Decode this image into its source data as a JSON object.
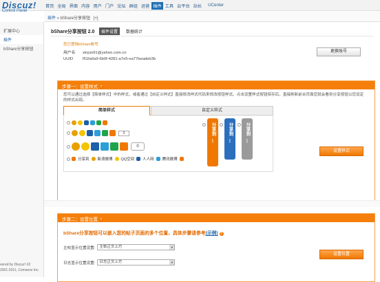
{
  "app": {
    "logo_name": "Discuz!",
    "logo_sub": "Control Panel"
  },
  "nav": {
    "items": [
      "首页",
      "全局",
      "界面",
      "内容",
      "用户",
      "门户",
      "论坛",
      "群组",
      "运营",
      "插件",
      "工具",
      "云平台",
      "站长",
      "UCenter"
    ],
    "active_index": 9
  },
  "breadcrumb": {
    "a": "插件",
    "b": "bShare分享按钮",
    "c": "[+]"
  },
  "sidebar": {
    "items": [
      "扩展中心",
      "插件",
      "bShare分享按钮"
    ],
    "active_index": 1,
    "footer_line1": "vered by Discuz! X2",
    "footer_line2": "2001-2011, Comsenz Inc."
  },
  "plugin": {
    "title": "bShare分享按钮 2.0",
    "tabs": [
      "插件设置",
      "数据统计"
    ],
    "notice": "您已登陆bShare帐号",
    "account": [
      {
        "label": "用户名",
        "value": "xinjun91@yahoo.com.cn"
      },
      {
        "label": "UUID",
        "value": "f51fa0a9-6b0f-4281-a7e5-ea77beadeb3b"
      }
    ],
    "change_account_label": "更换账号"
  },
  "step1": {
    "title": "步骤一：设置样式",
    "desc": "您可以通过选择【简单样式】中的样式，或者通过【自定义样式】直接修改样式代码来修改按钮样式。点击设置样式按钮保存后，直接刷新前台页面您就会看到分享按钮以您设定的样式出现。",
    "tab_simple": "简单样式",
    "tab_custom": "自定义样式",
    "count_small": "0",
    "count_large": "0",
    "share_label": "分享到",
    "service_labels": [
      "新浪微博",
      "QQ空间",
      "人人网",
      "腾讯微博"
    ],
    "vbtn_text": "分享到",
    "vbtn_colors": [
      "#f07800",
      "#2c6fbd",
      "#9a9a9a"
    ],
    "save_label": "设置样式"
  },
  "step2": {
    "title": "步骤二：设置位置",
    "headline": "bShare分享按钮可以嵌入您的帖子页面的多个位置，具体步骤请参考",
    "example_link": "[示例]",
    "rows": [
      {
        "label": "主帖显示位置设置:",
        "value": "主帖正文上方"
      },
      {
        "label": "日志显示位置设置:",
        "value": "日志正文上方"
      }
    ],
    "save_label": "设置位置"
  },
  "colors": {
    "accent": "#f57f0a",
    "brand": "#2366a8"
  }
}
